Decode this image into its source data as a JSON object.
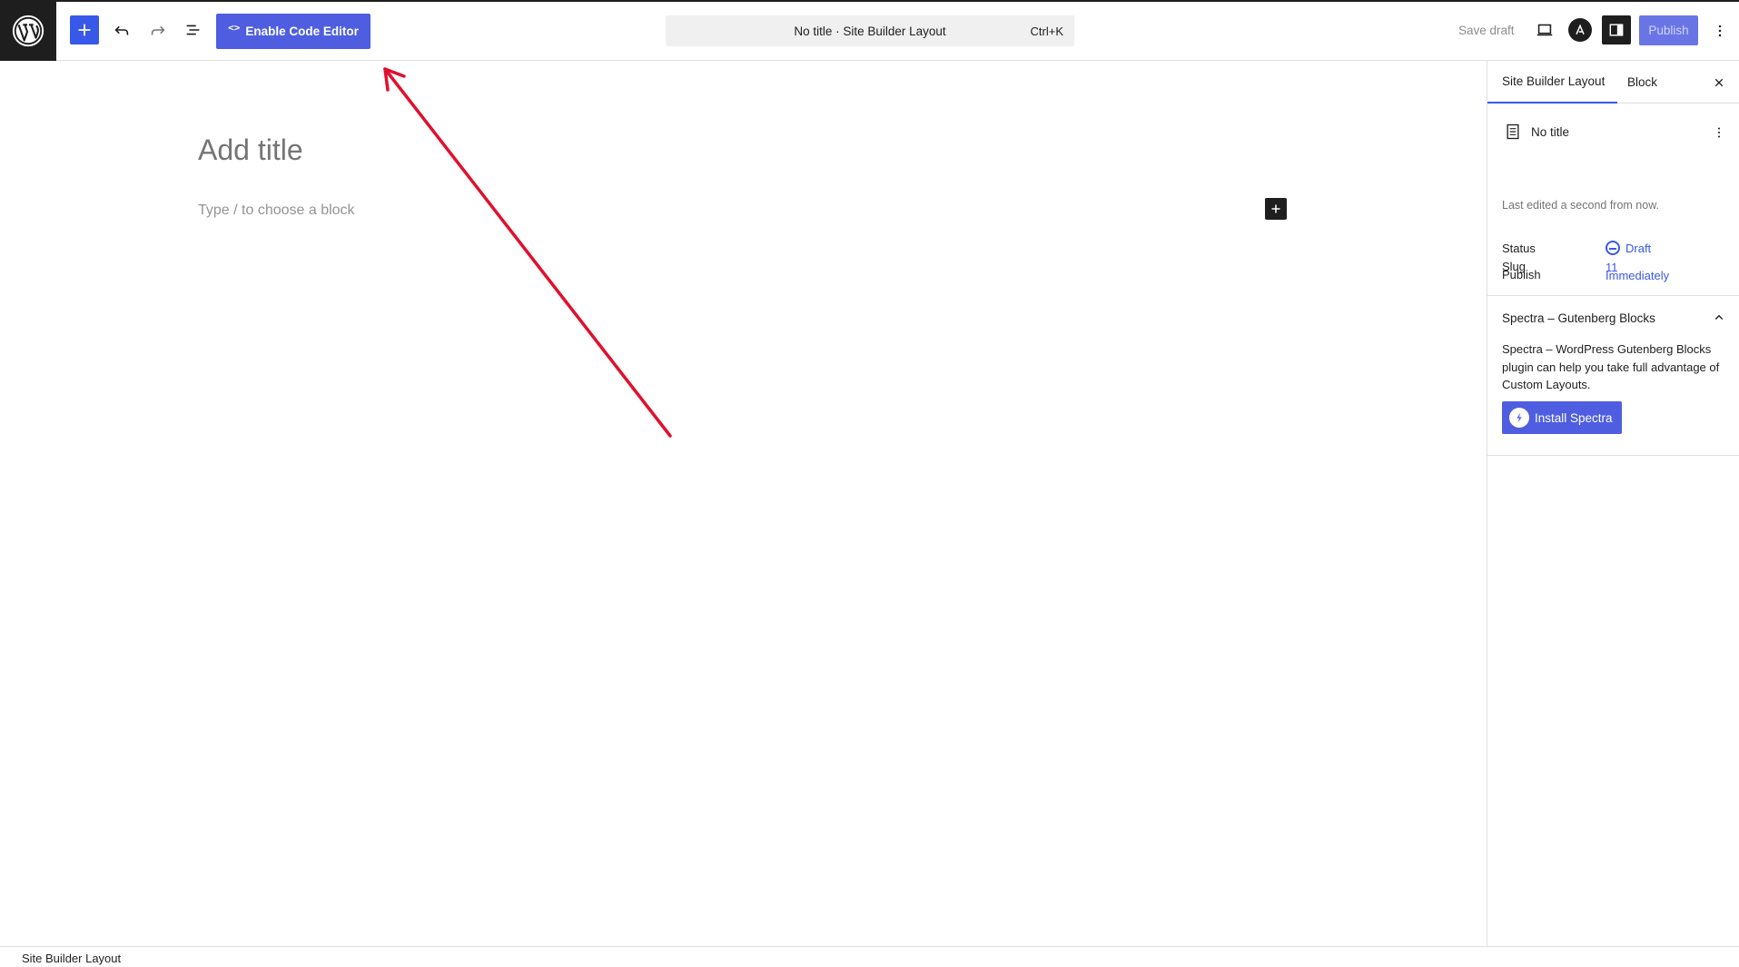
{
  "toolbar": {
    "code_editor_label": "Enable Code Editor",
    "code_editor_icon": "code-icon",
    "command_bar": {
      "title": "No title · Site Builder Layout",
      "shortcut": "Ctrl+K"
    },
    "save_draft_label": "Save draft",
    "publish_label": "Publish"
  },
  "editor": {
    "title_placeholder": "Add title",
    "block_placeholder": "Type / to choose a block"
  },
  "sidebar": {
    "tabs": [
      {
        "label": "Site Builder Layout",
        "active": true
      },
      {
        "label": "Block",
        "active": false
      }
    ],
    "summary": {
      "title": "No title",
      "last_edited": "Last edited a second from now.",
      "rows": [
        {
          "label": "Status",
          "value": "Draft"
        },
        {
          "label": "Publish",
          "value": "Immediately"
        },
        {
          "label": "Slug",
          "value": "11"
        }
      ]
    },
    "spectra": {
      "heading": "Spectra – Gutenberg Blocks",
      "description": "Spectra – WordPress Gutenberg Blocks plugin can help you take full advantage of Custom Layouts.",
      "install_label": "Install Spectra"
    }
  },
  "footer": {
    "breadcrumb": "Site Builder Layout"
  },
  "colors": {
    "accent": "#3858e9",
    "button": "#4f5ee0",
    "annotation_arrow": "#e0102e",
    "dark": "#1e1e1e"
  }
}
